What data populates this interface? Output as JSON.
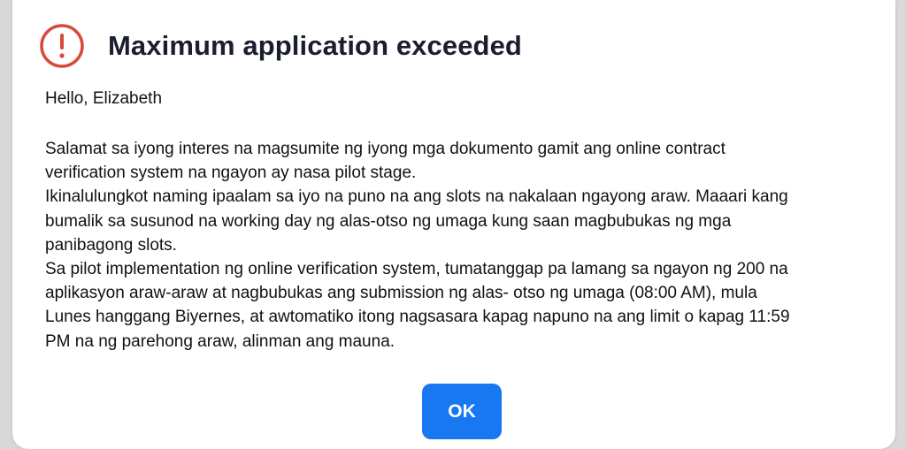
{
  "dialog": {
    "title": "Maximum application exceeded",
    "icon": "alert-circle-icon",
    "icon_color": "#d84a3a",
    "greeting": "Hello, Elizabeth",
    "body_lines": [
      "Salamat sa iyong interes na magsumite ng iyong mga dokumento gamit ang online contract",
      "verification system na ngayon ay nasa pilot stage.",
      "Ikinalulungkot naming ipaalam sa iyo na puno na ang slots na nakalaan ngayong araw. Maaari kang",
      "bumalik sa susunod na working day ng alas-otso ng umaga kung saan magbubukas ng mga",
      "panibagong slots.",
      "Sa pilot implementation ng online verification system, tumatanggap pa lamang sa ngayon ng 200 na",
      "aplikasyon araw-araw at nagbubukas ang submission ng alas- otso ng umaga (08:00 AM), mula",
      "Lunes hanggang Biyernes, at awtomatiko itong nagsasara kapag napuno na ang limit o kapag 11:59",
      "PM na ng parehong araw, alinman ang mauna."
    ],
    "ok_label": "OK",
    "ok_color": "#1778f2"
  }
}
